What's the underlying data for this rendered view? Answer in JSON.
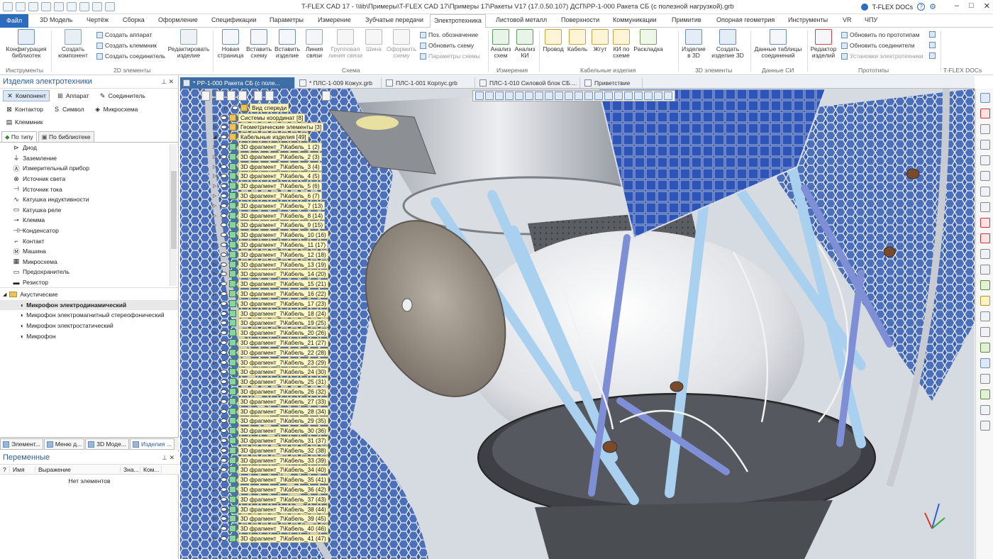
{
  "window": {
    "title": "T-FLEX CAD 17 - \\\\lib\\Примеры\\T-FLEX CAD 17\\Примеры 17\\Ракеты V17 (17.0.50.107) ДСП\\РР-1-000 Ракета СБ (с полезной нагрузкой).grb",
    "docs_label": "T-FLEX DOCs"
  },
  "ribbon_tabs": [
    {
      "label": "Файл"
    },
    {
      "label": "3D Модель"
    },
    {
      "label": "Чертёж"
    },
    {
      "label": "Сборка"
    },
    {
      "label": "Оформление"
    },
    {
      "label": "Спецификации"
    },
    {
      "label": "Параметры"
    },
    {
      "label": "Измерение"
    },
    {
      "label": "Зубчатые передачи"
    },
    {
      "label": "Электротехника"
    },
    {
      "label": "Листовой металл"
    },
    {
      "label": "Поверхности"
    },
    {
      "label": "Коммуникации"
    },
    {
      "label": "Примитив"
    },
    {
      "label": "Опорная геометрия"
    },
    {
      "label": "Инструменты"
    },
    {
      "label": "VR"
    },
    {
      "label": "ЧПУ"
    }
  ],
  "ribbon": {
    "config_lib": "Конфигурация библиотек",
    "create_component": "Создать компонент",
    "create_apparatus": "Создать аппарат",
    "create_clamp": "Создать клеммник",
    "create_connector": "Создать соединитель",
    "edit_item": "Редактировать изделие",
    "new_page": "Новая страница",
    "insert_scheme": "Вставить схему",
    "insert_item": "Вставить изделие",
    "link_line": "Линия связи",
    "group_link_line": "Групповая линия связи",
    "bus": "Шина",
    "format_scheme": "Оформить схему",
    "pos_designation": "Поз. обозначение",
    "update_scheme": "Обновить схему",
    "scheme_params": "Параметры схемы",
    "analysis_scheme": "Анализ схем",
    "analysis_ki": "Анализ КИ",
    "wire": "Провод",
    "cable": "Кабель",
    "harness": "Жгут",
    "ki_by_scheme": "КИ по схеме",
    "layout": "Раскладка",
    "item_3d": "Изделие в 3D",
    "create_item_3d": "Создать изделие 3D",
    "data_tables": "Данные таблицы соединений",
    "item_editor": "Редактор изделий",
    "update_by_proto": "Обновить по прототипам",
    "update_connectors": "Обновить соединители",
    "el_settings": "Установки электротехники",
    "groups": {
      "tools": "Инструменты",
      "el2d": "2D элементы",
      "scheme": "Схема",
      "measure": "Измерения",
      "cable_items": "Кабельные изделия",
      "el3d": "3D элементы",
      "data_si": "Данные СИ",
      "prototypes": "Прототипы",
      "docs": "T-FLEX DOCs"
    }
  },
  "left_panel": {
    "title": "Изделия электротехники",
    "component_buttons": [
      "Компонент",
      "Аппарат",
      "Соединитель",
      "Контактор",
      "Символ",
      "Микросхема",
      "Клеммник"
    ],
    "subtabs": [
      "По типу",
      "По библиотеке"
    ],
    "types": [
      "Диод",
      "Заземление",
      "Измерительный прибор",
      "Источник света",
      "Источник тока",
      "Катушка индуктивности",
      "Катушка реле",
      "Клемма",
      "Конденсатор",
      "Контакт",
      "Машина",
      "Микросхема",
      "Предохранитель",
      "Резистор"
    ],
    "category": "Акустические",
    "category_items": [
      "Микрофон электродинамический",
      "Микрофон электромагнитный стереофонический",
      "Микрофон электростатический",
      "Микрофон"
    ],
    "bottom_tabs": [
      "Элемент...",
      "Меню д...",
      "3D Моде...",
      "Изделия ..."
    ]
  },
  "variables": {
    "title": "Переменные",
    "columns": [
      "?",
      "Имя",
      "Выражение",
      "Зна...",
      "Ком..."
    ],
    "empty": "Нет элементов"
  },
  "doc_tabs": [
    {
      "label": "* РР-1-000 Ракета СБ (с поле..."
    },
    {
      "label": "* ПЛС-1-009 Кожух.grb"
    },
    {
      "label": "ПЛС-1-001 Корпус.grb"
    },
    {
      "label": "ПЛС-1-010 Силовой блок СБ...."
    },
    {
      "label": "Приветствие"
    }
  ],
  "model_tree": [
    {
      "label": "Вид спереди",
      "icon": "view",
      "expanded": false
    },
    {
      "label": "Системы координат [8]",
      "icon": "folder",
      "expanded": false
    },
    {
      "label": "Геометрические элементы [3]",
      "icon": "folder",
      "expanded": false
    },
    {
      "label": "Кабельные изделия [49]",
      "icon": "folder",
      "expanded": true
    },
    {
      "label": "3D фрагмент_7\\Кабель_1 (2)"
    },
    {
      "label": "3D фрагмент_7\\Кабель_2 (3)"
    },
    {
      "label": "3D фрагмент_7\\Кабель_3 (4)"
    },
    {
      "label": "3D фрагмент_7\\Кабель_4 (5)"
    },
    {
      "label": "3D фрагмент_7\\Кабель_5 (6)"
    },
    {
      "label": "3D фрагмент_7\\Кабель_6 (7)"
    },
    {
      "label": "3D фрагмент_7\\Кабель_7 (13)"
    },
    {
      "label": "3D фрагмент_7\\Кабель_8 (14)"
    },
    {
      "label": "3D фрагмент_7\\Кабель_9 (15)"
    },
    {
      "label": "3D фрагмент_7\\Кабель_10 (16)"
    },
    {
      "label": "3D фрагмент_7\\Кабель_11 (17)"
    },
    {
      "label": "3D фрагмент_7\\Кабель_12 (18)"
    },
    {
      "label": "3D фрагмент_7\\Кабель_13 (19)"
    },
    {
      "label": "3D фрагмент_7\\Кабель_14 (20)"
    },
    {
      "label": "3D фрагмент_7\\Кабель_15 (21)"
    },
    {
      "label": "3D фрагмент_7\\Кабель_16 (22)"
    },
    {
      "label": "3D фрагмент_7\\Кабель_17 (23)"
    },
    {
      "label": "3D фрагмент_7\\Кабель_18 (24)"
    },
    {
      "label": "3D фрагмент_7\\Кабель_19 (25)"
    },
    {
      "label": "3D фрагмент_7\\Кабель_20 (26)"
    },
    {
      "label": "3D фрагмент_7\\Кабель_21 (27)"
    },
    {
      "label": "3D фрагмент_7\\Кабель_22 (28)"
    },
    {
      "label": "3D фрагмент_7\\Кабель_23 (29)"
    },
    {
      "label": "3D фрагмент_7\\Кабель_24 (30)"
    },
    {
      "label": "3D фрагмент_7\\Кабель_25 (31)"
    },
    {
      "label": "3D фрагмент_7\\Кабель_26 (32)"
    },
    {
      "label": "3D фрагмент_7\\Кабель_27 (33)"
    },
    {
      "label": "3D фрагмент_7\\Кабель_28 (34)"
    },
    {
      "label": "3D фрагмент_7\\Кабель_29 (35)"
    },
    {
      "label": "3D фрагмент_7\\Кабель_30 (36)"
    },
    {
      "label": "3D фрагмент_7\\Кабель_31 (37)"
    },
    {
      "label": "3D фрагмент_7\\Кабель_32 (38)"
    },
    {
      "label": "3D фрагмент_7\\Кабель_33 (39)"
    },
    {
      "label": "3D фрагмент_7\\Кабель_34 (40)"
    },
    {
      "label": "3D фрагмент_7\\Кабель_35 (41)"
    },
    {
      "label": "3D фрагмент_7\\Кабель_36 (42)"
    },
    {
      "label": "3D фрагмент_7\\Кабель_37 (43)"
    },
    {
      "label": "3D фрагмент_7\\Кабель_38 (44)"
    },
    {
      "label": "3D фрагмент_7\\Кабель_39 (45)"
    },
    {
      "label": "3D фрагмент_7\\Кабель_40 (46)"
    },
    {
      "label": "3D фрагмент_7\\Кабель_41 (47)"
    }
  ],
  "colors": {
    "accent": "#2b6cbf",
    "panel_title": "#2b5c99",
    "hex_tiles": "#3d5fa8",
    "struts": "#9cc6e8",
    "solar_panel": "#1f3d8a"
  }
}
